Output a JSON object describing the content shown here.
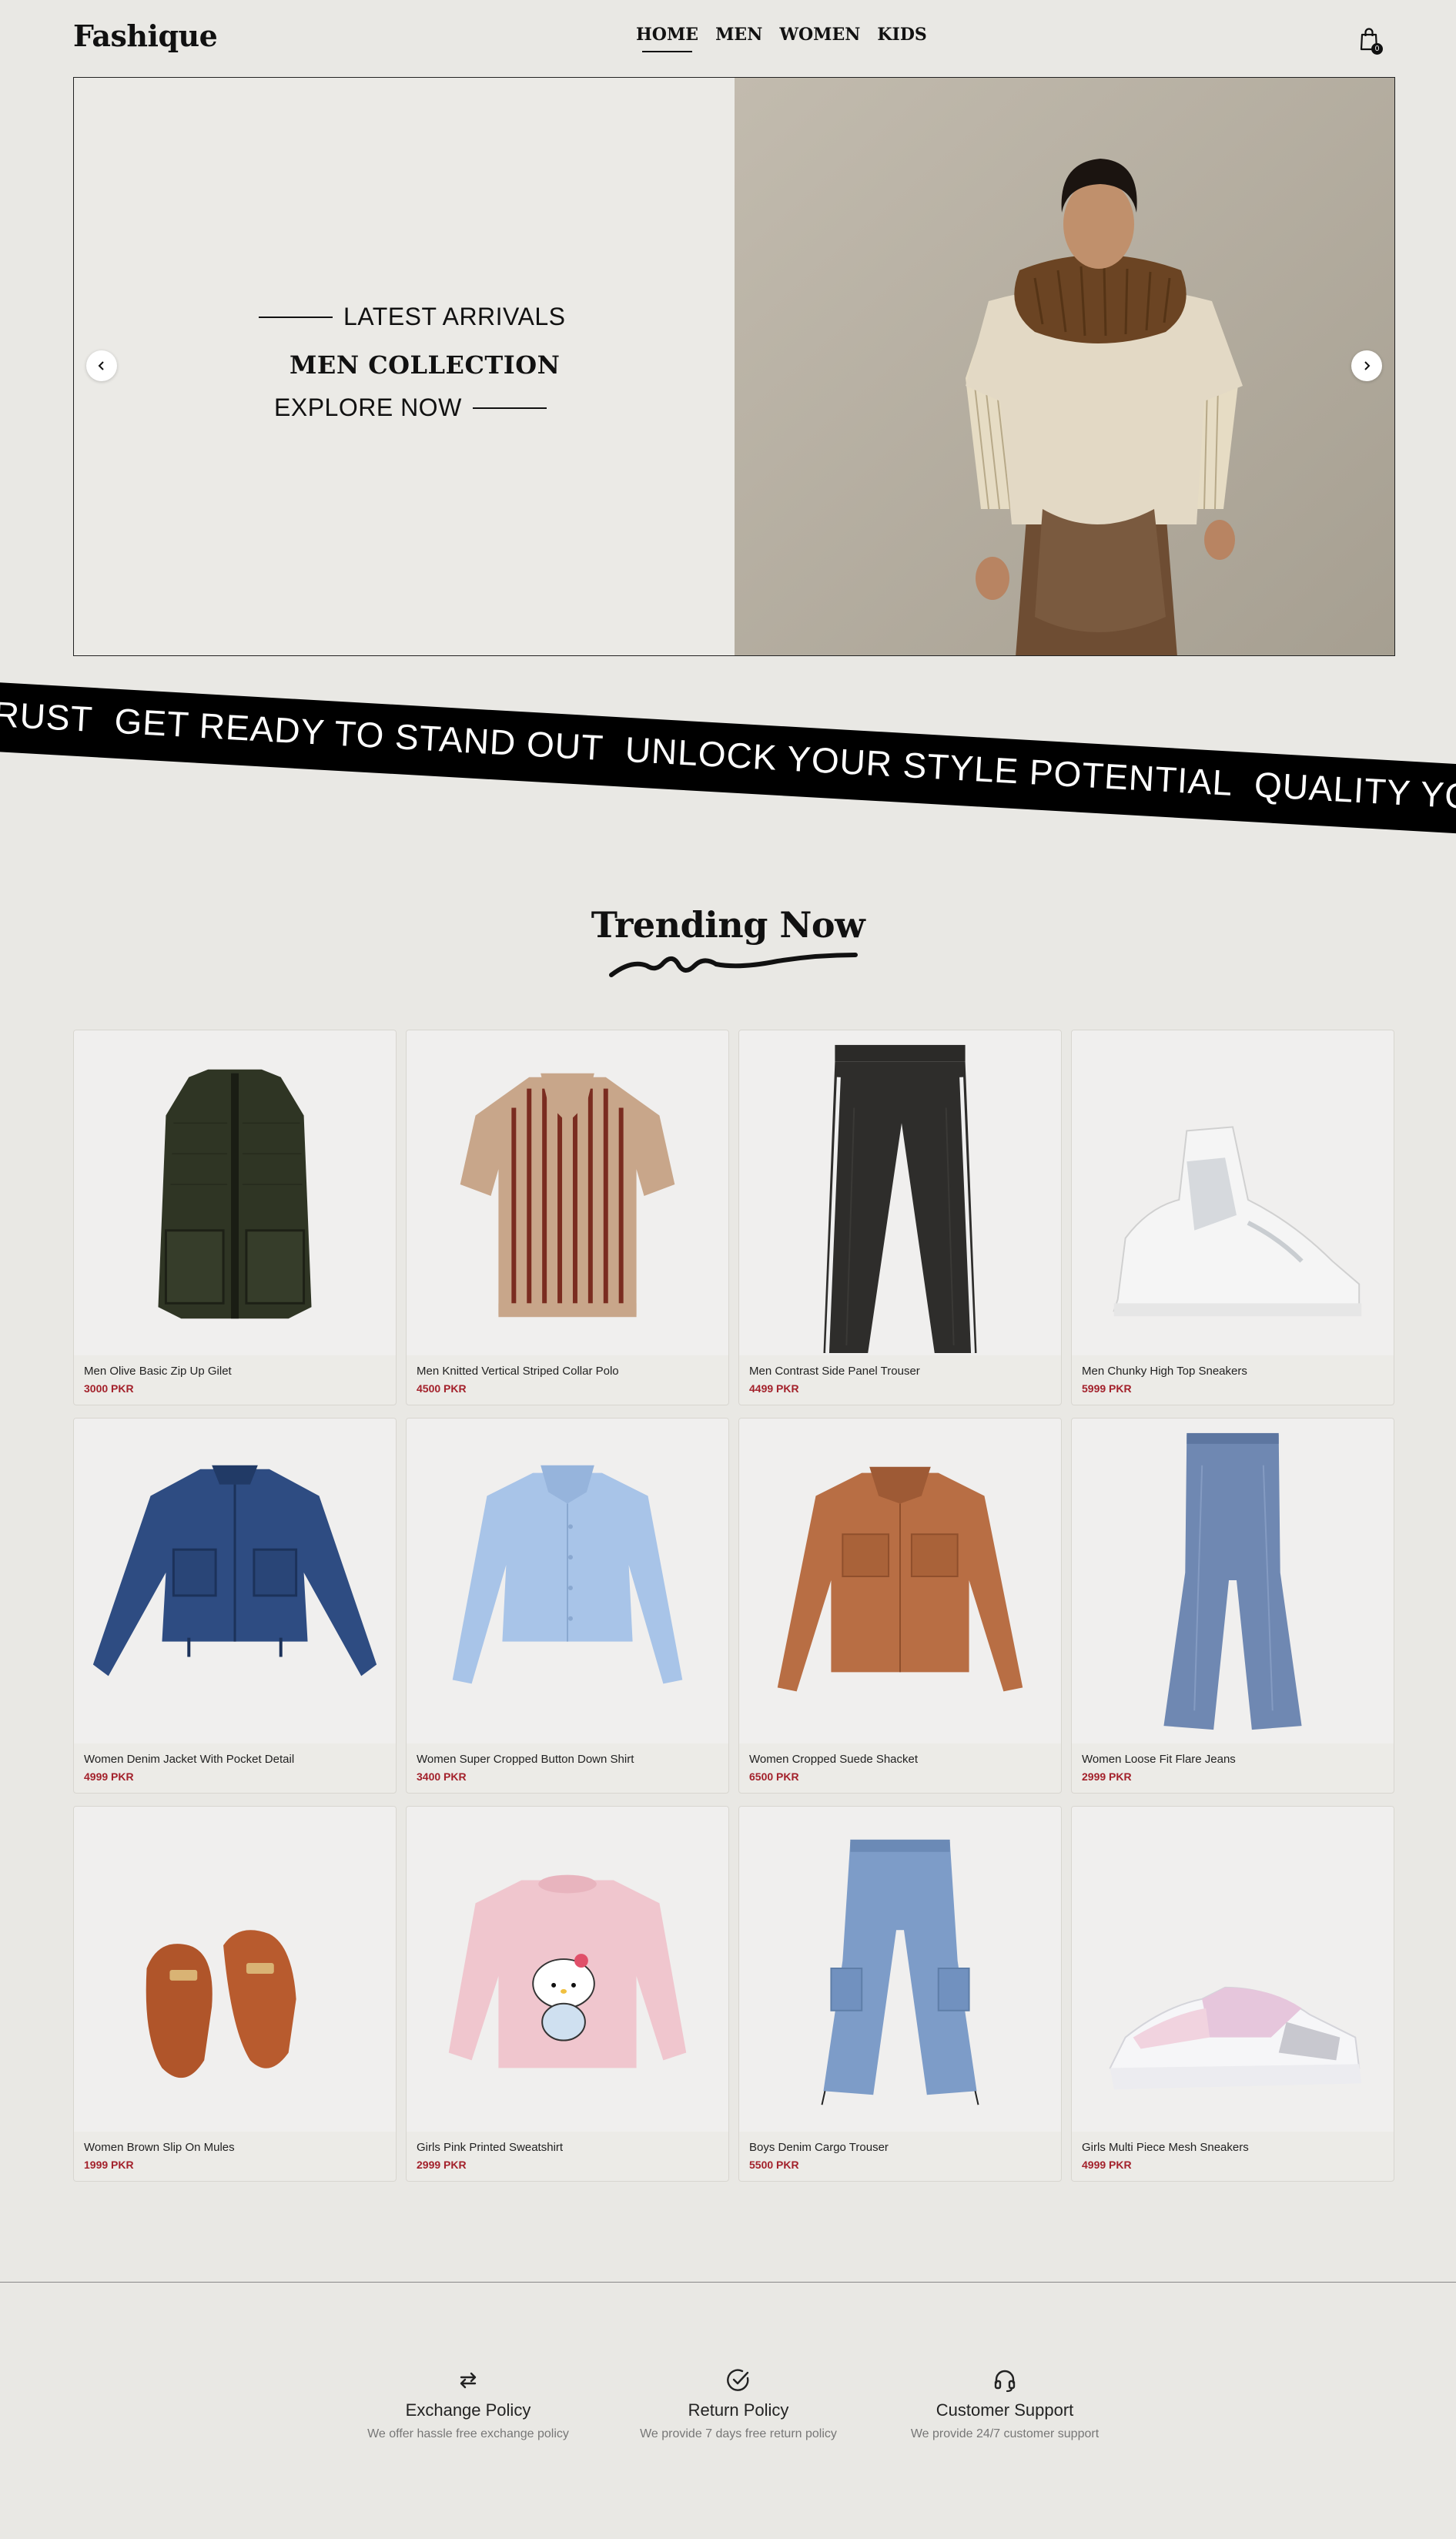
{
  "header": {
    "logo": "Fashique",
    "nav": [
      "HOME",
      "MEN",
      "WOMEN",
      "KIDS"
    ],
    "active_nav": "HOME",
    "cart_count": "0",
    "cart_icon": "shopping-bag-icon"
  },
  "hero": {
    "line1": "LATEST ARRIVALS",
    "line2": "MEN COLLECTION",
    "line3": "EXPLORE NOW",
    "prev_icon": "chevron-left-icon",
    "next_icon": "chevron-right-icon"
  },
  "ticker": {
    "phrases": [
      "RUST",
      "GET READY TO STAND OUT",
      "UNLOCK YOUR STYLE POTENTIAL",
      "QUALITY YOU C"
    ]
  },
  "trending": {
    "title": "Trending Now",
    "products": [
      {
        "name": "Men Olive Basic Zip Up Gilet",
        "price": "3000 PKR"
      },
      {
        "name": "Men Knitted Vertical Striped Collar Polo",
        "price": "4500 PKR"
      },
      {
        "name": "Men Contrast Side Panel Trouser",
        "price": "4499 PKR"
      },
      {
        "name": "Men Chunky High Top Sneakers",
        "price": "5999 PKR"
      },
      {
        "name": "Women Denim Jacket With Pocket Detail",
        "price": "4999 PKR"
      },
      {
        "name": "Women Super Cropped Button Down Shirt",
        "price": "3400 PKR"
      },
      {
        "name": "Women Cropped Suede Shacket",
        "price": "6500 PKR"
      },
      {
        "name": "Women Loose Fit Flare Jeans",
        "price": "2999 PKR"
      },
      {
        "name": "Women Brown Slip On Mules",
        "price": "1999 PKR"
      },
      {
        "name": "Girls Pink Printed Sweatshirt",
        "price": "2999 PKR"
      },
      {
        "name": "Boys Denim Cargo Trouser",
        "price": "5500 PKR"
      },
      {
        "name": "Girls Multi Piece Mesh Sneakers",
        "price": "4999 PKR"
      }
    ]
  },
  "features": [
    {
      "icon": "exchange-arrows-icon",
      "title": "Exchange Policy",
      "desc": "We offer hassle free exchange policy"
    },
    {
      "icon": "check-circle-icon",
      "title": "Return Policy",
      "desc": "We provide 7 days free return policy"
    },
    {
      "icon": "headphones-icon",
      "title": "Customer Support",
      "desc": "We provide 24/7 customer support"
    }
  ],
  "colors": {
    "background": "#e9e8e4",
    "price": "#a3212b",
    "ticker": "#000000"
  }
}
